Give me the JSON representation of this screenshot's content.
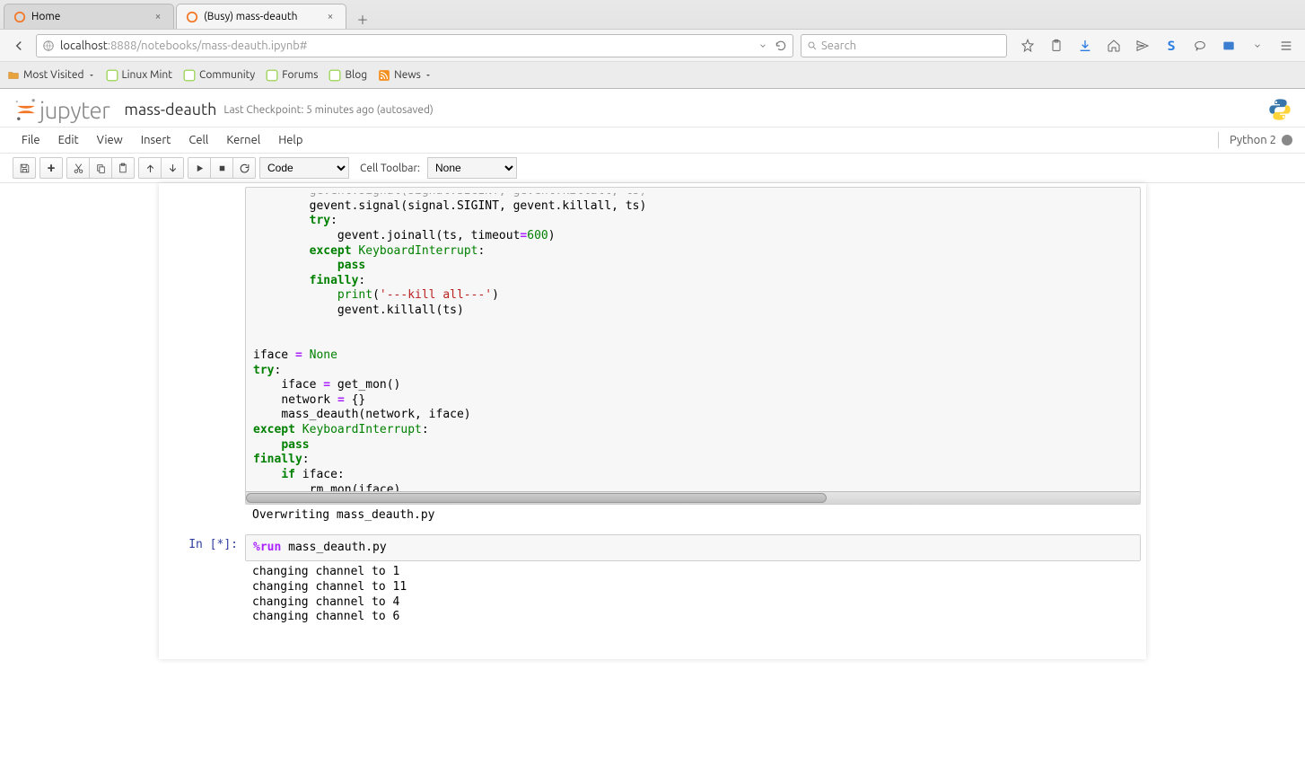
{
  "browser": {
    "tabs": [
      {
        "title": "Home",
        "active": false
      },
      {
        "title": "(Busy) mass-deauth",
        "active": true
      }
    ],
    "url": {
      "host": "localhost",
      "port": ":8888",
      "path": "/notebooks/mass-deauth.ipynb#"
    },
    "search_placeholder": "Search",
    "bookmarks": [
      {
        "label": "Most Visited",
        "icon": "folder",
        "dropdown": true
      },
      {
        "label": "Linux Mint",
        "icon": "mint"
      },
      {
        "label": "Community",
        "icon": "mint"
      },
      {
        "label": "Forums",
        "icon": "mint"
      },
      {
        "label": "Blog",
        "icon": "mint"
      },
      {
        "label": "News",
        "icon": "rss",
        "dropdown": true
      }
    ]
  },
  "jupyter": {
    "brand": "jupyter",
    "notebook_name": "mass-deauth",
    "checkpoint": "Last Checkpoint: 5 minutes ago (autosaved)",
    "menus": [
      "File",
      "Edit",
      "View",
      "Insert",
      "Cell",
      "Kernel",
      "Help"
    ],
    "kernel_name": "Python 2",
    "toolbar": {
      "celltype": "Code",
      "celltoolbar_label": "Cell Toolbar:",
      "celltoolbar_value": "None"
    }
  },
  "cells": {
    "code1_lines": [
      {
        "indent": 8,
        "tokens": [
          {
            "t": "nm",
            "v": "gevent.signal(signal.SIGINT, gevent.killall, ts)"
          }
        ]
      },
      {
        "indent": 8,
        "tokens": [
          {
            "t": "kw",
            "v": "try"
          },
          {
            "t": "nm",
            "v": ":"
          }
        ]
      },
      {
        "indent": 12,
        "tokens": [
          {
            "t": "nm",
            "v": "gevent.joinall(ts, timeout"
          },
          {
            "t": "op",
            "v": "="
          },
          {
            "t": "num",
            "v": "600"
          },
          {
            "t": "nm",
            "v": ")"
          }
        ]
      },
      {
        "indent": 8,
        "tokens": [
          {
            "t": "kw",
            "v": "except"
          },
          {
            "t": "nm",
            "v": " "
          },
          {
            "t": "bi",
            "v": "KeyboardInterrupt"
          },
          {
            "t": "nm",
            "v": ":"
          }
        ]
      },
      {
        "indent": 12,
        "tokens": [
          {
            "t": "kw",
            "v": "pass"
          }
        ]
      },
      {
        "indent": 8,
        "tokens": [
          {
            "t": "kw",
            "v": "finally"
          },
          {
            "t": "nm",
            "v": ":"
          }
        ]
      },
      {
        "indent": 12,
        "tokens": [
          {
            "t": "bi",
            "v": "print"
          },
          {
            "t": "nm",
            "v": "("
          },
          {
            "t": "str",
            "v": "'---kill all---'"
          },
          {
            "t": "nm",
            "v": ")"
          }
        ]
      },
      {
        "indent": 12,
        "tokens": [
          {
            "t": "nm",
            "v": "gevent.killall(ts)"
          }
        ]
      },
      {
        "indent": 0,
        "tokens": []
      },
      {
        "indent": 0,
        "tokens": []
      },
      {
        "indent": 0,
        "tokens": [
          {
            "t": "nm",
            "v": "iface "
          },
          {
            "t": "op",
            "v": "="
          },
          {
            "t": "nm",
            "v": " "
          },
          {
            "t": "bi",
            "v": "None"
          }
        ]
      },
      {
        "indent": 0,
        "tokens": [
          {
            "t": "kw",
            "v": "try"
          },
          {
            "t": "nm",
            "v": ":"
          }
        ]
      },
      {
        "indent": 4,
        "tokens": [
          {
            "t": "nm",
            "v": "iface "
          },
          {
            "t": "op",
            "v": "="
          },
          {
            "t": "nm",
            "v": " get_mon()"
          }
        ]
      },
      {
        "indent": 4,
        "tokens": [
          {
            "t": "nm",
            "v": "network "
          },
          {
            "t": "op",
            "v": "="
          },
          {
            "t": "nm",
            "v": " {}"
          }
        ]
      },
      {
        "indent": 4,
        "tokens": [
          {
            "t": "nm",
            "v": "mass_deauth(network, iface)"
          }
        ]
      },
      {
        "indent": 0,
        "tokens": [
          {
            "t": "kw",
            "v": "except"
          },
          {
            "t": "nm",
            "v": " "
          },
          {
            "t": "bi",
            "v": "KeyboardInterrupt"
          },
          {
            "t": "nm",
            "v": ":"
          }
        ]
      },
      {
        "indent": 4,
        "tokens": [
          {
            "t": "kw",
            "v": "pass"
          }
        ]
      },
      {
        "indent": 0,
        "tokens": [
          {
            "t": "kw",
            "v": "finally"
          },
          {
            "t": "nm",
            "v": ":"
          }
        ]
      },
      {
        "indent": 4,
        "tokens": [
          {
            "t": "kw",
            "v": "if"
          },
          {
            "t": "nm",
            "v": " iface:"
          }
        ]
      },
      {
        "indent": 8,
        "tokens": [
          {
            "t": "nm",
            "v": "rm_mon(iface)"
          }
        ]
      }
    ],
    "out1": "Overwriting mass_deauth.py",
    "prompt2": "In [*]:",
    "code2_magic": "%run",
    "code2_rest": " mass_deauth.py",
    "out2": "changing channel to 1\nchanging channel to 11\nchanging channel to 4\nchanging channel to 6"
  }
}
